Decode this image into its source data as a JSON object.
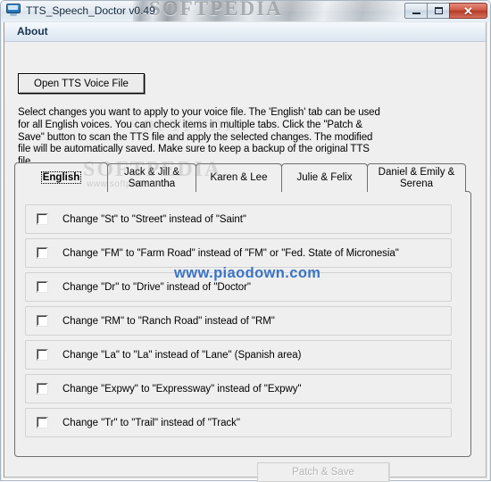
{
  "window": {
    "title": "TTS_Speech_Doctor v0.49",
    "icon": "monitor-speech-icon",
    "controls": {
      "minimize": "minimize-button",
      "maximize": "maximize-button",
      "close_label": "✕"
    }
  },
  "menubar": {
    "items": [
      "About"
    ]
  },
  "toolbar": {
    "open_label": "Open TTS Voice File"
  },
  "description": "Select changes you want to apply to your voice file. The 'English' tab can be used for all English voices. You can check items in multiple tabs. Click the \"Patch & Save\" button to scan the TTS file and apply the selected changes. The modified file will be automatically saved. Make sure to keep a backup of the original TTS file.",
  "tabs": [
    {
      "label": "English",
      "active": true
    },
    {
      "label": "Jack & Jill & Samantha",
      "active": false
    },
    {
      "label": "Karen & Lee",
      "active": false
    },
    {
      "label": "Julie & Felix",
      "active": false
    },
    {
      "label": "Daniel & Emily & Serena",
      "active": false
    }
  ],
  "checklist": [
    {
      "label": "Change \"St\" to \"Street\" instead of \"Saint\"",
      "checked": false
    },
    {
      "label": "Change \"FM\" to \"Farm Road\" instead of \"FM\" or \"Fed. State of Micronesia\"",
      "checked": false
    },
    {
      "label": "Change \"Dr\" to \"Drive\" instead of \"Doctor\"",
      "checked": false
    },
    {
      "label": "Change \"RM\" to \"Ranch Road\" instead of \"RM\"",
      "checked": false
    },
    {
      "label": "Change \"La\" to \"La\" instead of \"Lane\" (Spanish area)",
      "checked": false
    },
    {
      "label": "Change \"Expwy\" to \"Expressway\" instead of \"Expwy\"",
      "checked": false
    },
    {
      "label": "Change \"Tr\" to \"Trail\" instead of \"Track\"",
      "checked": false
    }
  ],
  "footer": {
    "patch_label": "Patch & Save",
    "patch_enabled": false
  },
  "watermarks": {
    "top": "SOFTPEDIA",
    "tabs_big": "SOFTPEDIA",
    "tabs_small": "www.softpedia.com",
    "center": "www.piaodown.com"
  },
  "colors": {
    "accent_blue": "#3a74c4",
    "title_text": "#10263c",
    "close_red": "#b33c27",
    "disabled_text": "#b4b4b4"
  }
}
